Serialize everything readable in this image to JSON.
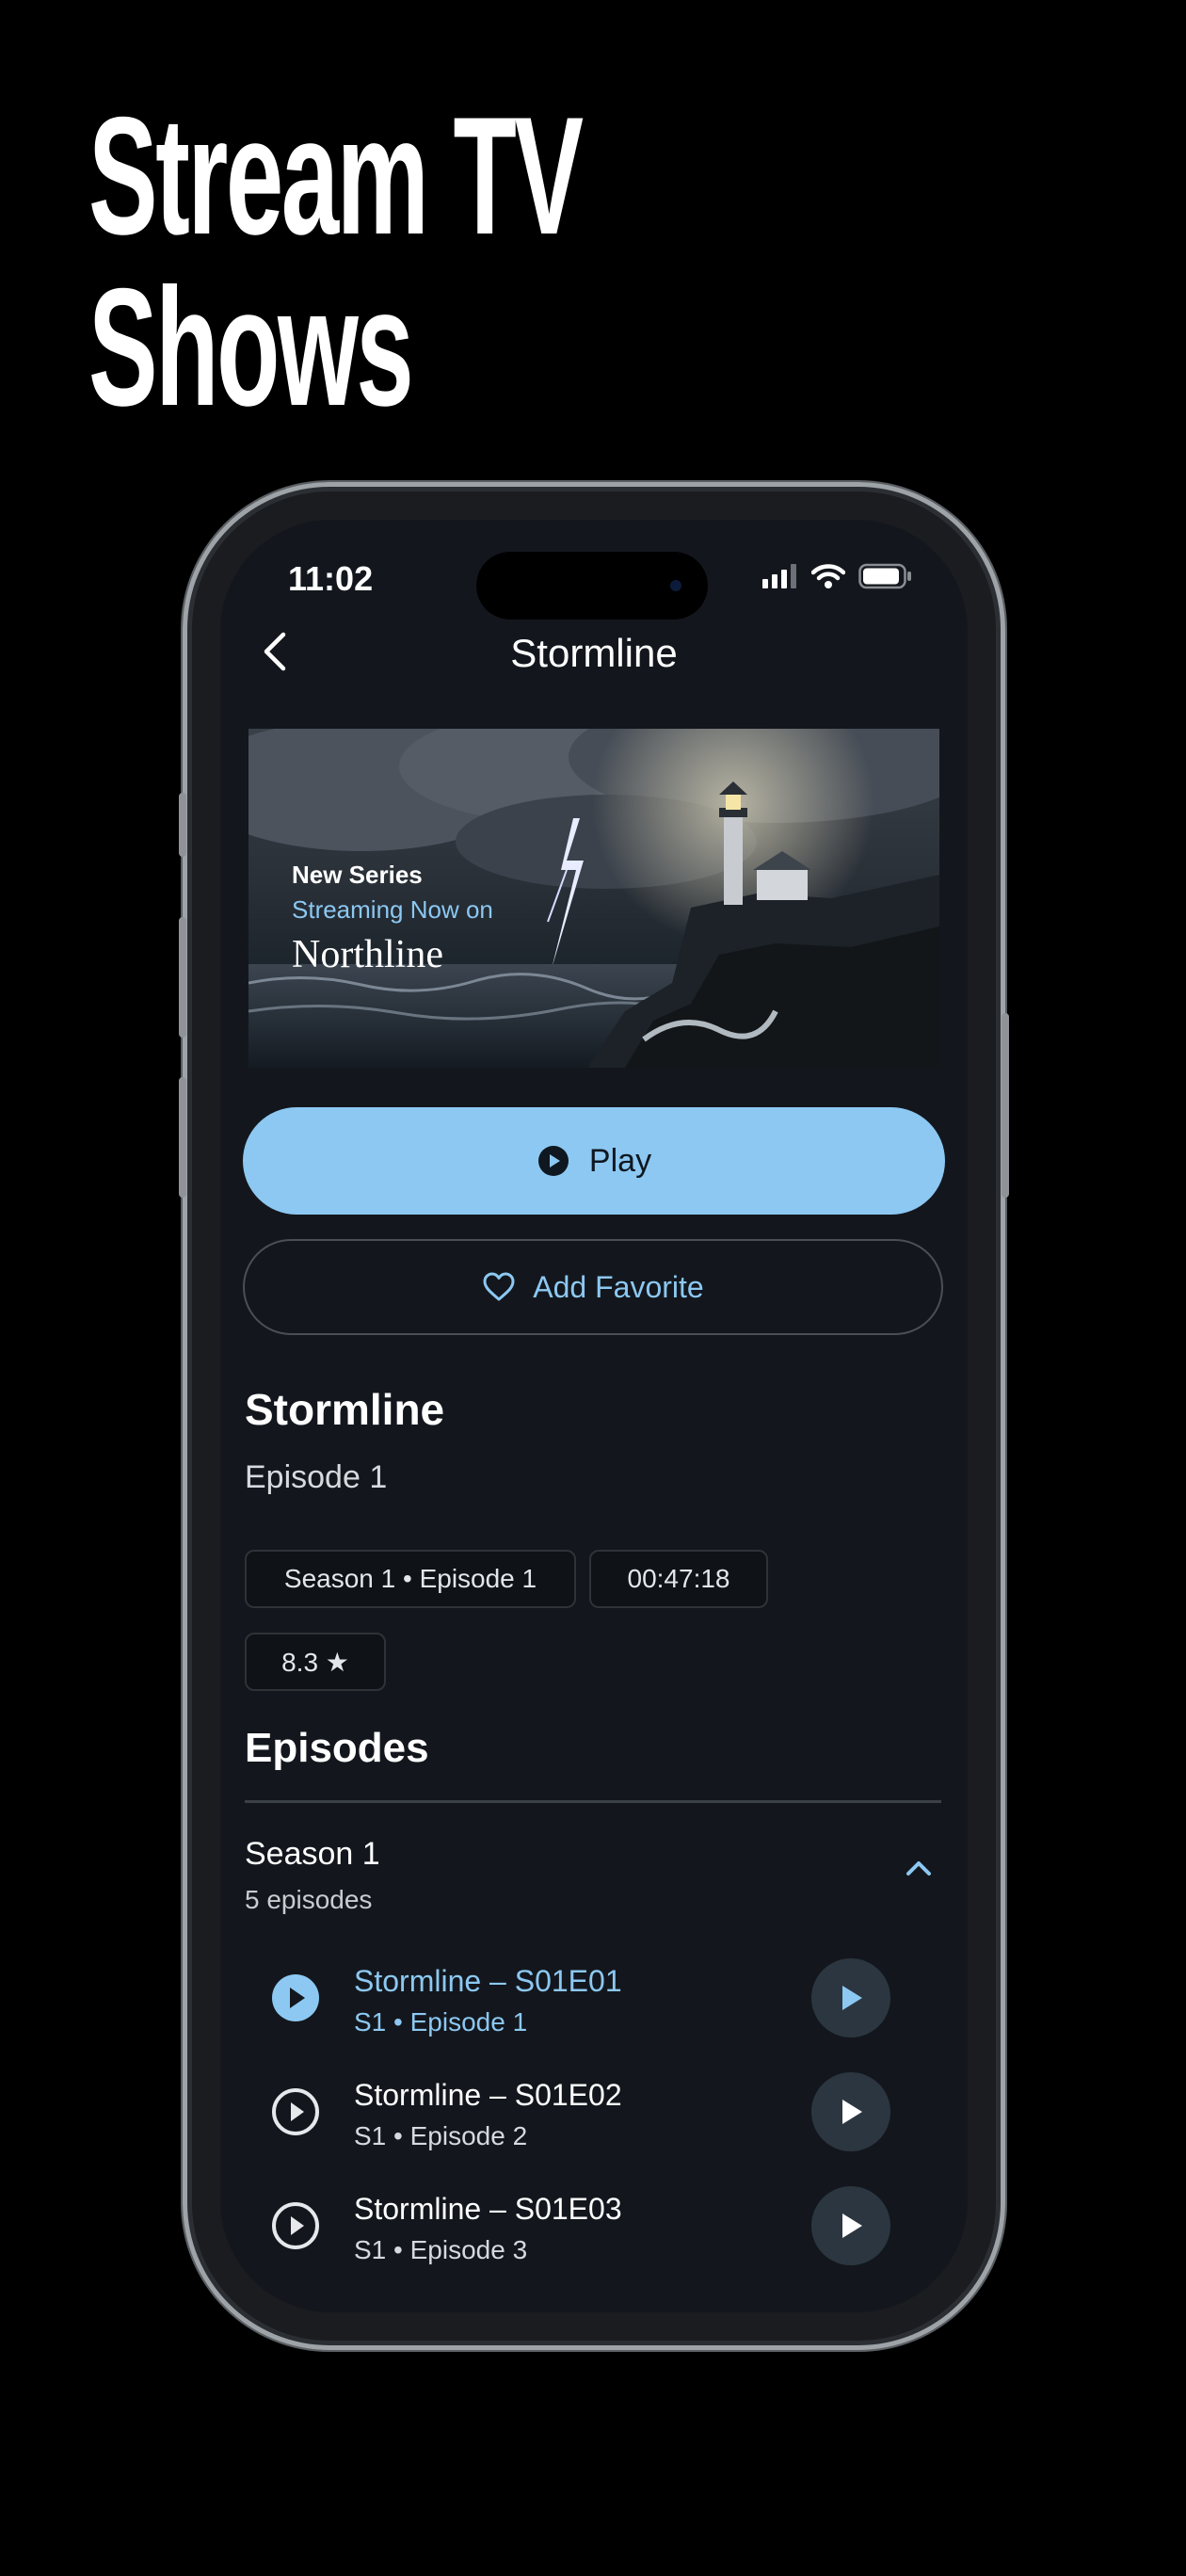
{
  "headline": [
    "Stream TV",
    "Shows"
  ],
  "status": {
    "time": "11:02"
  },
  "nav": {
    "title": "Stormline",
    "back_icon": "chevron-left-icon"
  },
  "hero": {
    "line1": "New Series",
    "line2": "Streaming Now on",
    "line3": "Northline"
  },
  "actions": {
    "play_label": "Play",
    "favorite_label": "Add Favorite"
  },
  "show": {
    "title": "Stormline",
    "subtitle": "Episode 1",
    "chips": [
      "Season 1 • Episode 1",
      "00:47:18",
      "8.3 ★"
    ]
  },
  "episodes_section": {
    "title": "Episodes",
    "season": {
      "title": "Season 1",
      "count": "5 episodes",
      "expanded": true
    },
    "items": [
      {
        "title": "Stormline – S01E01",
        "subtitle": "S1 • Episode 1",
        "active": true
      },
      {
        "title": "Stormline – S01E02",
        "subtitle": "S1 • Episode 2",
        "active": false
      },
      {
        "title": "Stormline – S01E03",
        "subtitle": "S1 • Episode 3",
        "active": false
      }
    ]
  },
  "colors": {
    "accent": "#8cc8f2",
    "background": "#13171d",
    "play_button_bg": "#2c3640"
  }
}
